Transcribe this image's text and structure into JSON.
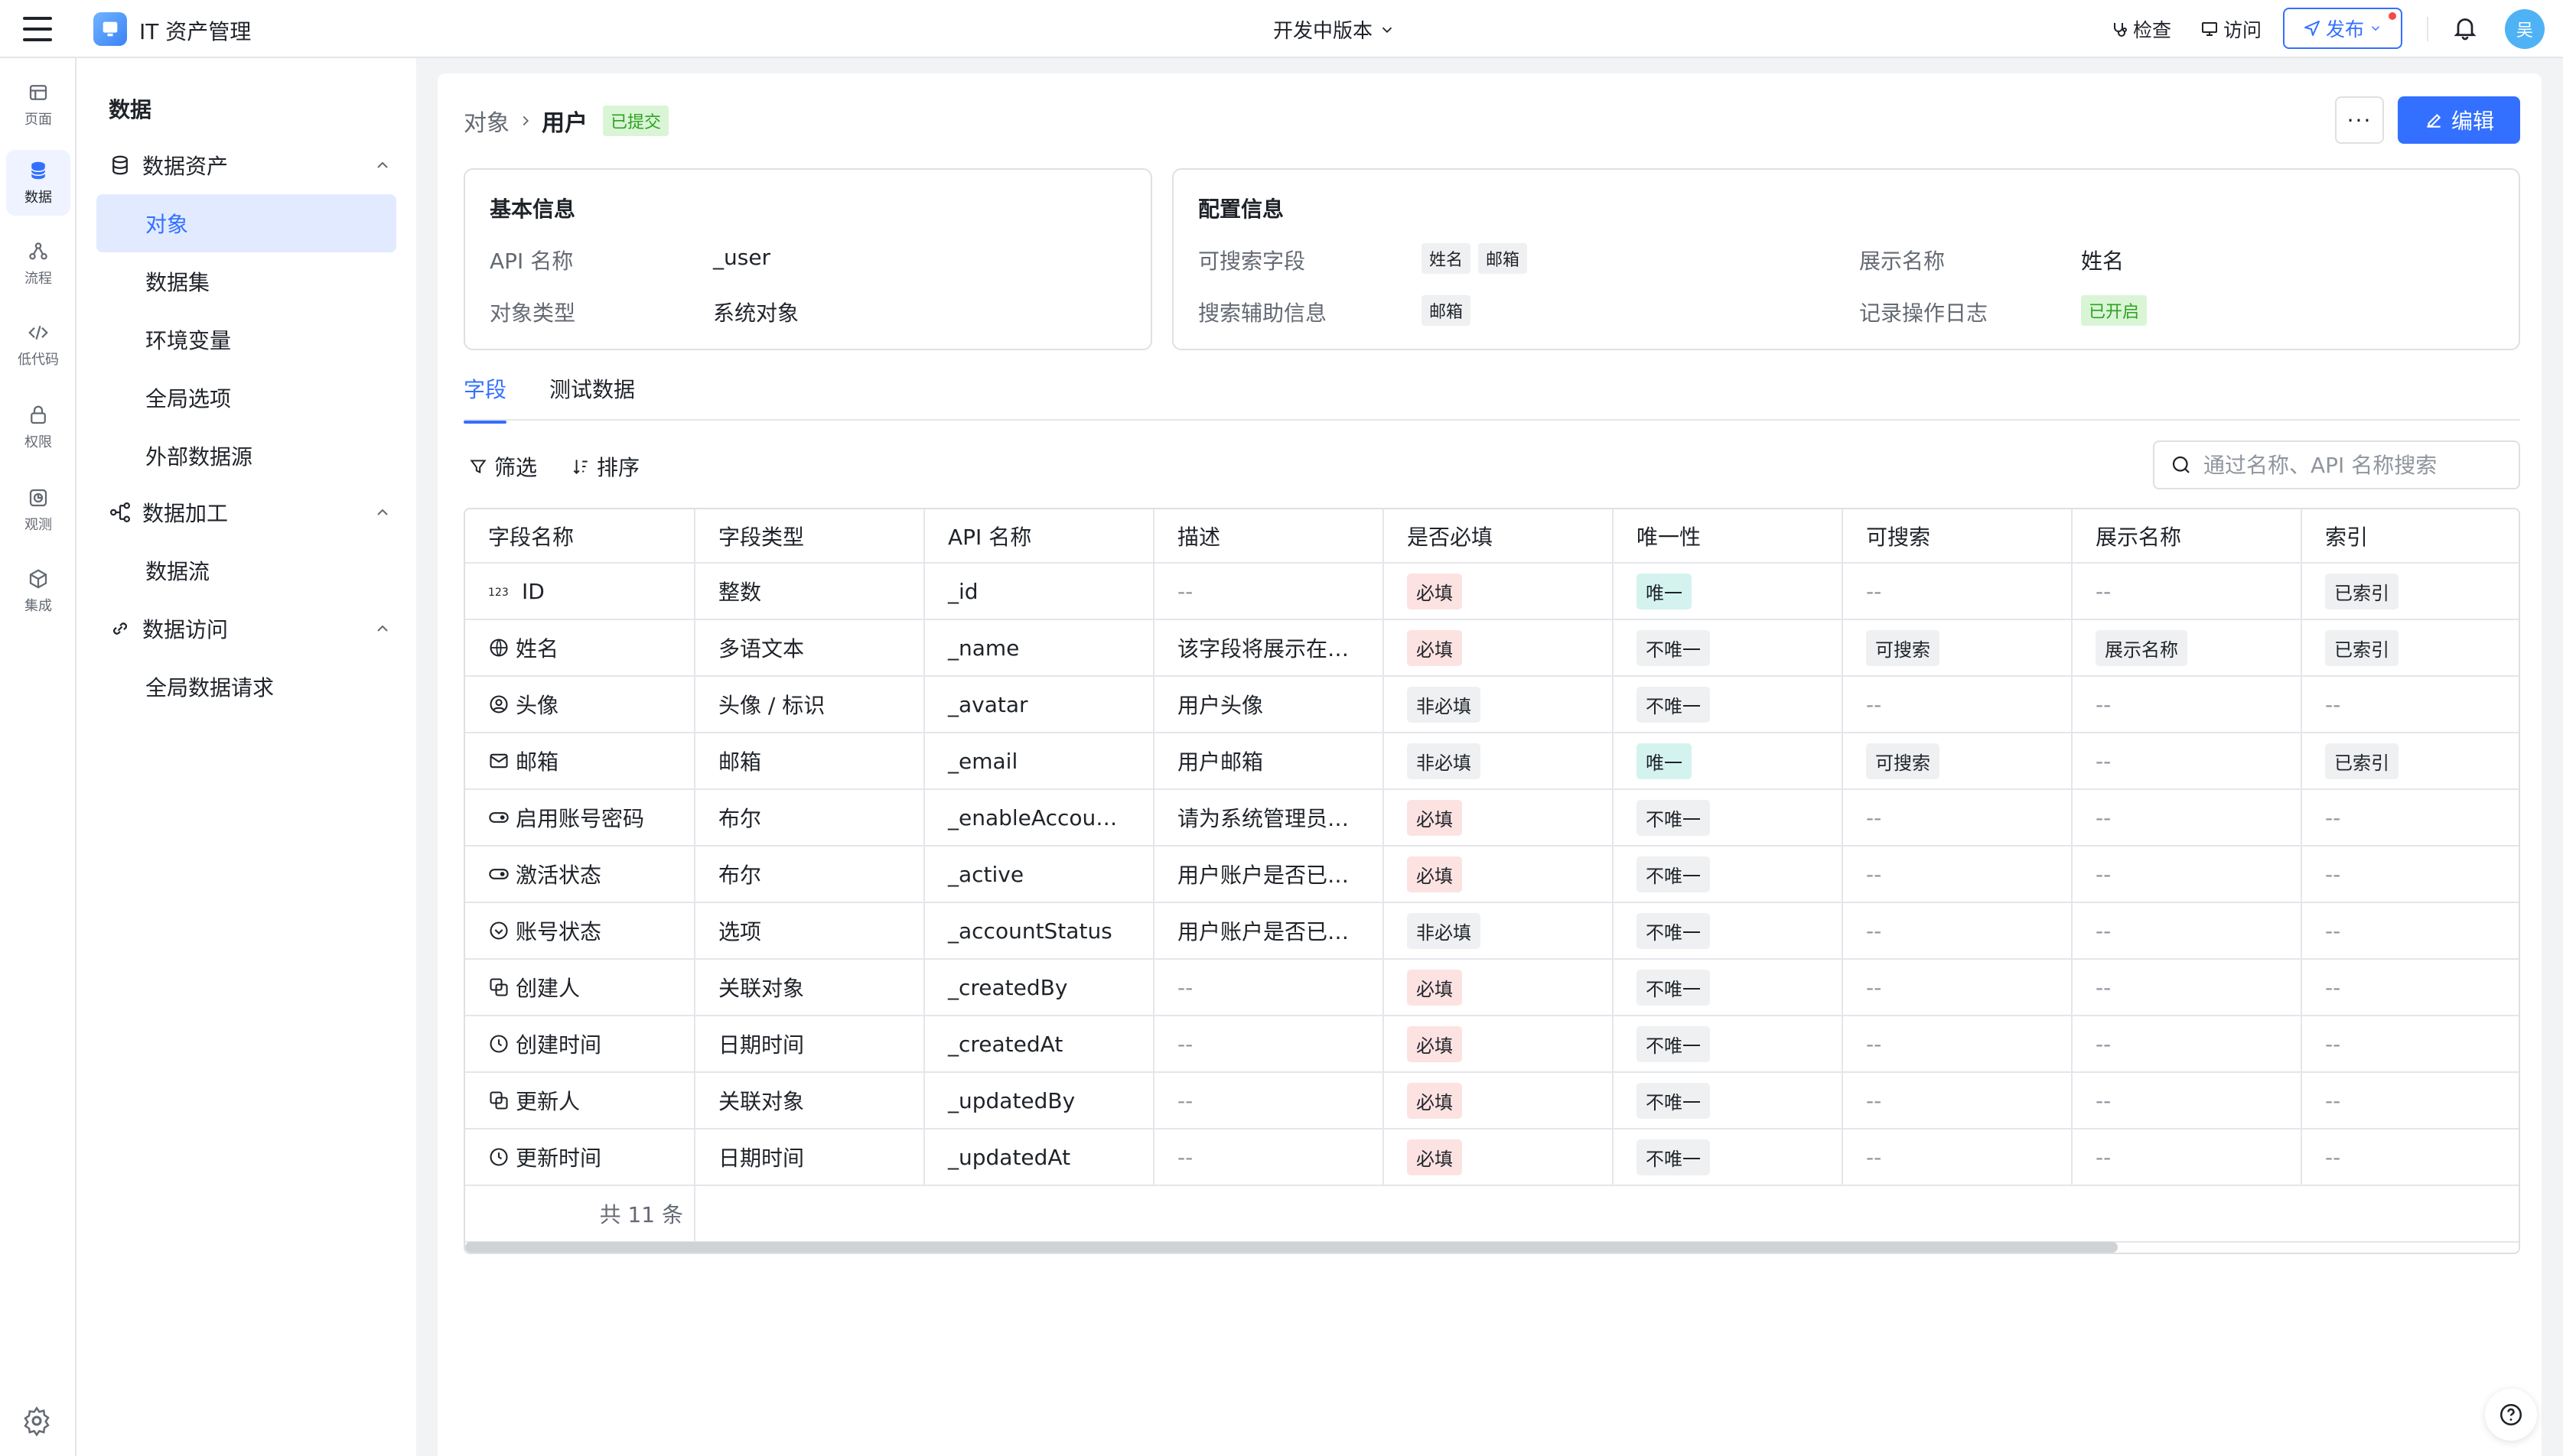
{
  "header": {
    "app_title": "IT 资产管理",
    "version_label": "开发中版本",
    "check_label": "检查",
    "visit_label": "访问",
    "publish_label": "发布",
    "avatar_text": "吴"
  },
  "rail": {
    "items": [
      {
        "label": "页面",
        "icon": "page-icon"
      },
      {
        "label": "数据",
        "icon": "database-icon"
      },
      {
        "label": "流程",
        "icon": "flow-icon"
      },
      {
        "label": "低代码",
        "icon": "code-icon"
      },
      {
        "label": "权限",
        "icon": "lock-icon"
      },
      {
        "label": "观测",
        "icon": "observe-icon"
      },
      {
        "label": "集成",
        "icon": "cube-icon"
      }
    ]
  },
  "sidebar": {
    "title": "数据",
    "groups": [
      {
        "label": "数据资产",
        "items": [
          "对象",
          "数据集",
          "环境变量",
          "全局选项",
          "外部数据源"
        ]
      },
      {
        "label": "数据加工",
        "items": [
          "数据流"
        ]
      },
      {
        "label": "数据访问",
        "items": [
          "全局数据请求"
        ]
      }
    ]
  },
  "breadcrumb": {
    "root": "对象",
    "current": "用户",
    "status": "已提交"
  },
  "actions": {
    "more": "···",
    "edit": "编辑"
  },
  "basic_info": {
    "title": "基本信息",
    "api_label": "API 名称",
    "api_value": "_user",
    "type_label": "对象类型",
    "type_value": "系统对象"
  },
  "config_info": {
    "title": "配置信息",
    "searchable_label": "可搜索字段",
    "searchable_tags": [
      "姓名",
      "邮箱"
    ],
    "aux_label": "搜索辅助信息",
    "aux_tags": [
      "邮箱"
    ],
    "display_label": "展示名称",
    "display_value": "姓名",
    "log_label": "记录操作日志",
    "log_value": "已开启"
  },
  "tabs": [
    "字段",
    "测试数据"
  ],
  "toolbar": {
    "filter": "筛选",
    "sort": "排序",
    "search_placeholder": "通过名称、API 名称搜索"
  },
  "table": {
    "columns": [
      "字段名称",
      "字段类型",
      "API 名称",
      "描述",
      "是否必填",
      "唯一性",
      "可搜索",
      "展示名称",
      "索引"
    ],
    "rows": [
      {
        "icon": "number-icon",
        "name": "ID",
        "type": "整数",
        "api": "_id",
        "desc": "--",
        "required": "必填",
        "unique": "唯一",
        "searchable": "--",
        "display": "--",
        "index": "已索引"
      },
      {
        "icon": "globe-icon",
        "name": "姓名",
        "type": "多语文本",
        "api": "_name",
        "desc": "该字段将展示在报...",
        "required": "必填",
        "unique": "不唯一",
        "searchable": "可搜索",
        "display": "展示名称",
        "index": "已索引"
      },
      {
        "icon": "avatar-icon",
        "name": "头像",
        "type": "头像 / 标识",
        "api": "_avatar",
        "desc": "用户头像",
        "required": "非必填",
        "unique": "不唯一",
        "searchable": "--",
        "display": "--",
        "index": "--"
      },
      {
        "icon": "mail-icon",
        "name": "邮箱",
        "type": "邮箱",
        "api": "_email",
        "desc": "用户邮箱",
        "required": "非必填",
        "unique": "唯一",
        "searchable": "可搜索",
        "display": "--",
        "index": "已索引"
      },
      {
        "icon": "toggle-icon",
        "name": "启用账号密码",
        "type": "布尔",
        "api": "_enableAccountPa...",
        "desc": "请为系统管理员启...",
        "required": "必填",
        "unique": "不唯一",
        "searchable": "--",
        "display": "--",
        "index": "--"
      },
      {
        "icon": "toggle-icon",
        "name": "激活状态",
        "type": "布尔",
        "api": "_active",
        "desc": "用户账户是否已启用",
        "required": "必填",
        "unique": "不唯一",
        "searchable": "--",
        "display": "--",
        "index": "--"
      },
      {
        "icon": "option-icon",
        "name": "账号状态",
        "type": "选项",
        "api": "_accountStatus",
        "desc": "用户账户是否已登录",
        "required": "非必填",
        "unique": "不唯一",
        "searchable": "--",
        "display": "--",
        "index": "--"
      },
      {
        "icon": "link-object-icon",
        "name": "创建人",
        "type": "关联对象",
        "api": "_createdBy",
        "desc": "--",
        "required": "必填",
        "unique": "不唯一",
        "searchable": "--",
        "display": "--",
        "index": "--"
      },
      {
        "icon": "clock-icon",
        "name": "创建时间",
        "type": "日期时间",
        "api": "_createdAt",
        "desc": "--",
        "required": "必填",
        "unique": "不唯一",
        "searchable": "--",
        "display": "--",
        "index": "--"
      },
      {
        "icon": "link-object-icon",
        "name": "更新人",
        "type": "关联对象",
        "api": "_updatedBy",
        "desc": "--",
        "required": "必填",
        "unique": "不唯一",
        "searchable": "--",
        "display": "--",
        "index": "--"
      },
      {
        "icon": "clock-icon",
        "name": "更新时间",
        "type": "日期时间",
        "api": "_updatedAt",
        "desc": "--",
        "required": "必填",
        "unique": "不唯一",
        "searchable": "--",
        "display": "--",
        "index": "--"
      }
    ],
    "total": "共 11 条"
  },
  "colors": {
    "accent": "#3370ff",
    "required": "#fde2e2",
    "unique": "#d4f3ef",
    "submitted": "#d9f5d6"
  }
}
